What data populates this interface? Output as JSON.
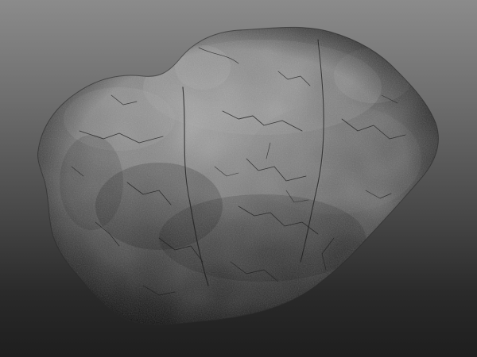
{
  "scene": {
    "subject": "rock",
    "colors": {
      "background_top": "#8b8b8b",
      "background_bottom": "#1e1e1e",
      "rock_light": "#9a9a9a",
      "rock_mid": "#6b6b6b",
      "rock_dark": "#262626",
      "crack": "#1c1c1c"
    }
  }
}
